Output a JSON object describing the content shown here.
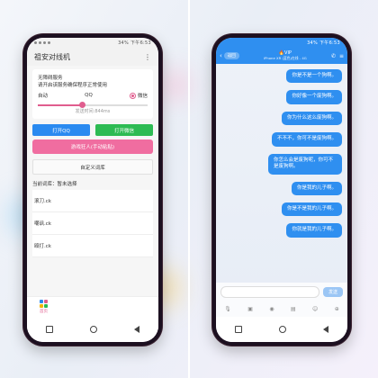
{
  "left": {
    "status_time": "34% 下午6:53",
    "app_title": "祖安对线机",
    "menu_glyph": "⋮",
    "card": {
      "line1": "无障碍服务",
      "line2": "请开启该服务确保程序正常使用",
      "options": [
        "自动",
        "QQ",
        "微信"
      ],
      "selected": "微信",
      "send_interval_value": 0.4,
      "send_interval_text": "发送时间:844ms"
    },
    "open_qq": "打开QQ",
    "open_wechat": "打开微信",
    "start_button": "游戏狂人(手动粘贴)",
    "custom_words": "自定义词库",
    "current_words": "当前词库：暂未选择",
    "list_items": [
      "滚刀.ck",
      "嘲讽.ck",
      "殴打.ck"
    ],
    "nav_home": "首页",
    "colors": {
      "accent": "#e05d8e",
      "qq": "#2a8af0",
      "wechat": "#2dbb53"
    }
  },
  "right": {
    "status_time": "34% 下午6:53",
    "back_label": "返回",
    "chat_name": "🔥VIP",
    "chat_sub": "iPhone XR (蓝色)在线 - 4G",
    "messages": [
      "你是不是一个狗啊。",
      "你好像一个废狗啊。",
      "你为什么这么废狗啊。",
      "不不不，你可不是废狗啊。",
      "你怎么会是废狗呢，你可不是废狗啊。",
      "你是我的儿子啊。",
      "你是不是我的儿子啊。",
      "你就是我的儿子啊。"
    ],
    "send_label": "发送",
    "tool_icons": [
      "mic-icon",
      "image-icon",
      "camera-icon",
      "red-packet-icon",
      "emoji-icon",
      "plus-icon"
    ],
    "colors": {
      "bubble": "#2f8ff0"
    }
  }
}
